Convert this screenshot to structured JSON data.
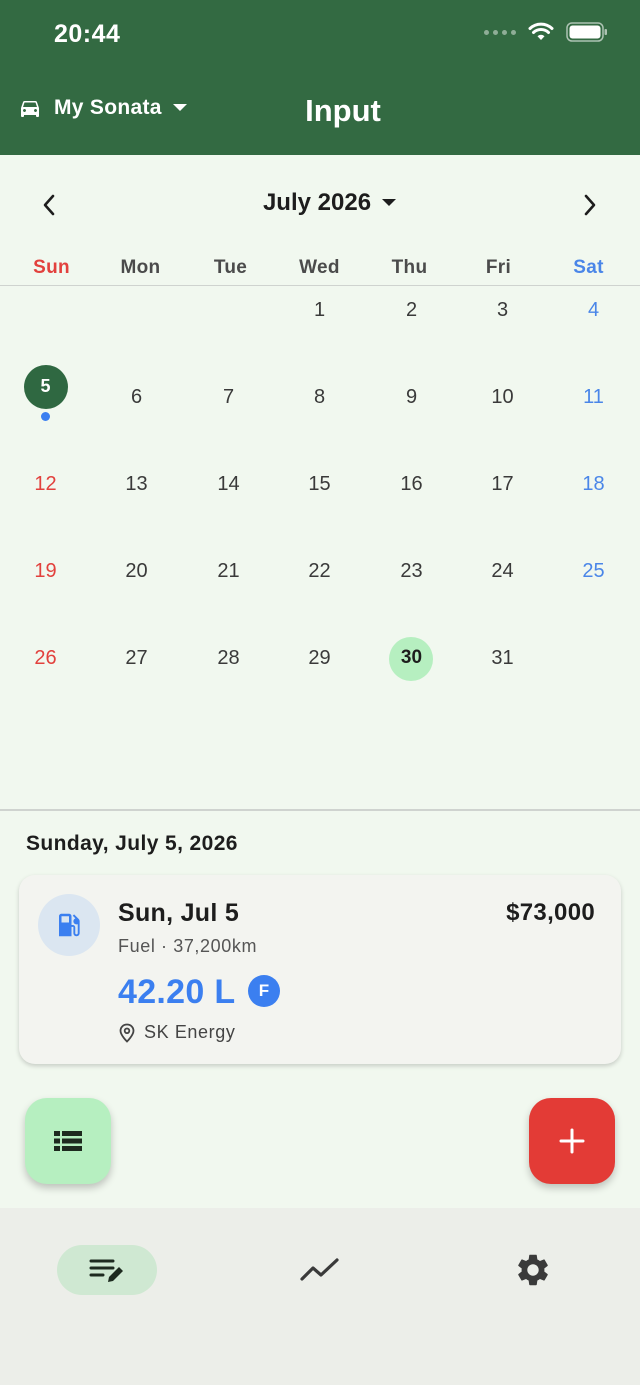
{
  "status_bar": {
    "time": "20:44"
  },
  "header": {
    "car_name": "My Sonata",
    "title": "Input"
  },
  "calendar": {
    "month_label": "July 2026",
    "weekdays": [
      "Sun",
      "Mon",
      "Tue",
      "Wed",
      "Thu",
      "Fri",
      "Sat"
    ],
    "first_weekday_index": 3,
    "days_in_month": 31,
    "selected_day": 5,
    "today": 30,
    "days_with_entries": [
      5
    ]
  },
  "selected_date_heading": "Sunday, July 5, 2026",
  "entry": {
    "date": "Sun, Jul 5",
    "amount": "$73,000",
    "meta": "Fuel · 37,200km",
    "volume": "42.20 L",
    "badge": "F",
    "station": "SK Energy"
  },
  "colors": {
    "header": "#336a42",
    "sunday": "#e2413d",
    "saturday": "#4a86e8",
    "accent_blue": "#3b7ff0",
    "fab_add": "#e33b36",
    "fab_list": "#b6efc0"
  },
  "icons": {
    "car": "car-icon",
    "prev": "chevron-left-icon",
    "next": "chevron-right-icon",
    "fuel": "fuel-pump-icon",
    "location": "location-pin-icon",
    "list": "list-icon",
    "add": "plus-icon",
    "nav": [
      "edit-notes-icon",
      "trend-line-icon",
      "settings-gear-icon"
    ]
  }
}
